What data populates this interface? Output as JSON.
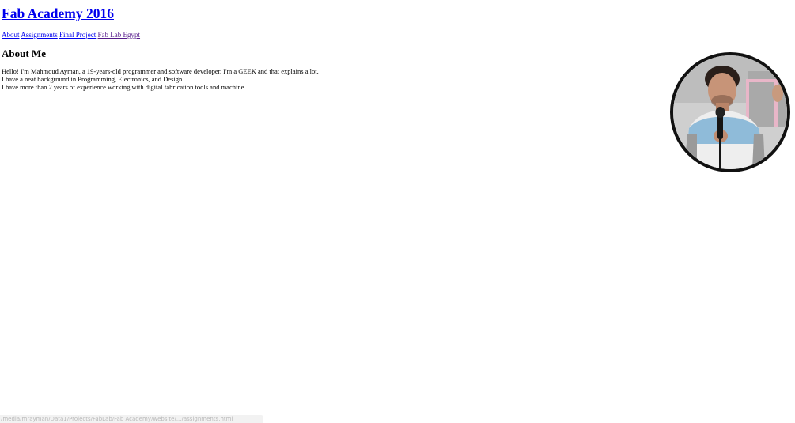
{
  "header": {
    "title": "Fab Academy 2016"
  },
  "nav": {
    "items": [
      {
        "label": "About"
      },
      {
        "label": "Assignments"
      },
      {
        "label": "Final Project"
      },
      {
        "label": "Fab Lab Egypt"
      }
    ]
  },
  "about": {
    "heading": "About Me",
    "paragraphs": [
      "Hello! I'm Mahmoud Ayman, a 19-years-old programmer and software developer. I'm a GEEK and that explains a lot.",
      "I have a neat background in Programming, Electronics, and Design.",
      "I have more than 2 years of experience working with digital fabrication tools and machine."
    ]
  },
  "status_bar": {
    "url": "/media/mrayman/Data1/Projects/FabLab/Fab Academy/website/.../assignments.html"
  },
  "colors": {
    "link": "#0000ee",
    "visited_link": "#551a8b",
    "avatar_border": "#111111"
  }
}
